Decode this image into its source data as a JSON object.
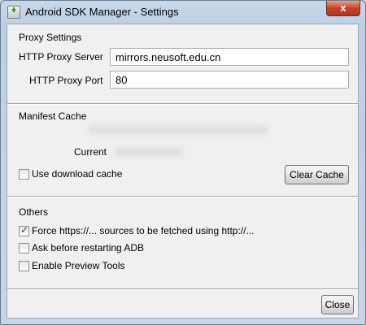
{
  "window": {
    "title": "Android SDK Manager - Settings",
    "close_glyph": "x"
  },
  "proxy": {
    "group_title": "Proxy Settings",
    "server_label": "HTTP Proxy Server",
    "server_value": "mirrors.neusoft.edu.cn",
    "port_label": "HTTP Proxy Port",
    "port_value": "80"
  },
  "manifest": {
    "group_title": "Manifest Cache",
    "current_label": "Current",
    "use_cache_label": "Use download cache",
    "use_cache_checked": false,
    "clear_button": "Clear Cache"
  },
  "others": {
    "group_title": "Others",
    "items": [
      {
        "label": "Force https://... sources to be fetched using http://...",
        "checked": true
      },
      {
        "label": "Ask before restarting ADB",
        "checked": false
      },
      {
        "label": "Enable Preview Tools",
        "checked": false
      }
    ]
  },
  "footer": {
    "close_button": "Close"
  }
}
